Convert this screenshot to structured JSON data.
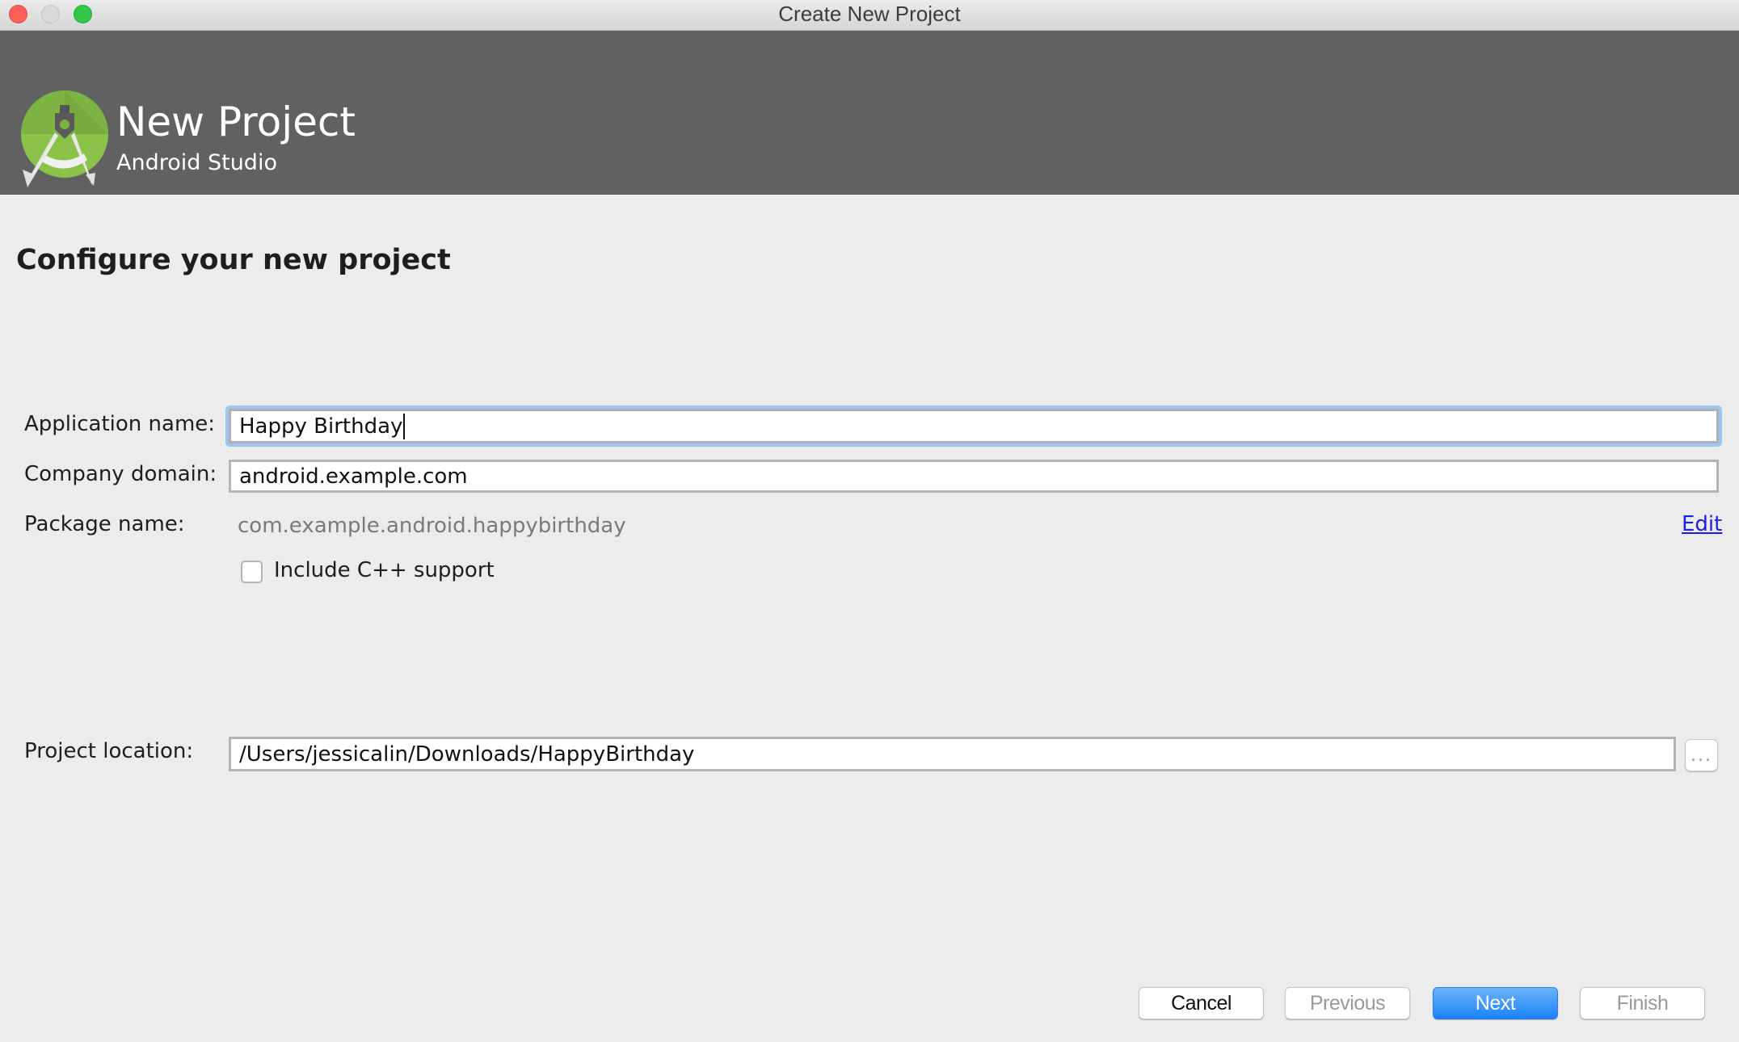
{
  "window": {
    "title": "Create New Project",
    "traffic_lights": [
      "close",
      "minimize",
      "maximize"
    ]
  },
  "header": {
    "title": "New Project",
    "subtitle": "Android Studio",
    "logo_icon": "android-studio-logo-icon"
  },
  "page": {
    "heading": "Configure your new project"
  },
  "form": {
    "application_name": {
      "label": "Application name:",
      "value": "Happy Birthday"
    },
    "company_domain": {
      "label": "Company domain:",
      "value": "android.example.com"
    },
    "package_name": {
      "label": "Package name:",
      "value": "com.example.android.happybirthday",
      "edit_label": "Edit"
    },
    "cpp_support": {
      "label": "Include C++ support",
      "checked": false
    },
    "project_location": {
      "label": "Project location:",
      "value": "/Users/jessicalin/Downloads/HappyBirthday",
      "browse_label": "..."
    }
  },
  "buttons": {
    "cancel": "Cancel",
    "previous": "Previous",
    "next": "Next",
    "finish": "Finish"
  },
  "colors": {
    "header_bg": "#616161",
    "primary_button": "#1a82fb",
    "focus_ring": "#9cc5f0",
    "link": "#1d1de8"
  }
}
